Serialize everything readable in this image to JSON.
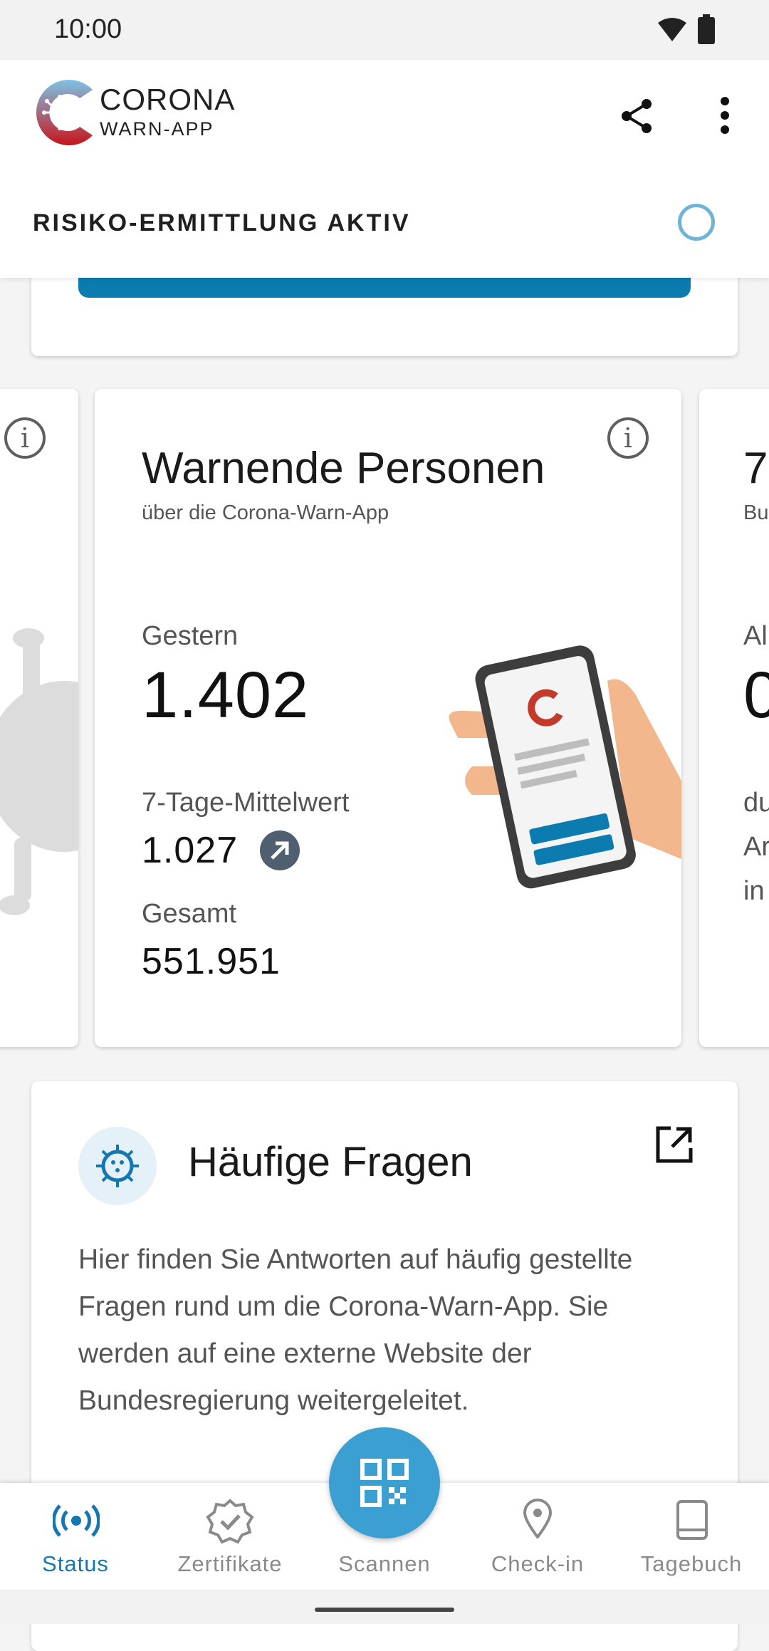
{
  "status_bar": {
    "time": "10:00"
  },
  "header": {
    "logo_line1": "CORONA",
    "logo_line2": "WARN-APP",
    "risk_label": "RISIKO-ERMITTLUNG AKTIV"
  },
  "stat_card": {
    "title": "Warnende Personen",
    "subtitle": "über die Corona-Warn-App",
    "yesterday_label": "Gestern",
    "yesterday_value": "1.402",
    "avg_label": "7-Tage-Mittelwert",
    "avg_value": "1.027",
    "total_label": "Gesamt",
    "total_value": "551.951"
  },
  "right_card_peek": {
    "title": "7",
    "subtitle": "Bu",
    "label": "Al",
    "value": "0",
    "line1": "du",
    "line2": "Ar",
    "line3": "in"
  },
  "faq": {
    "title": "Häufige Fragen",
    "body": "Hier finden Sie Antworten auf häufig gestellte Fragen rund um die Corona-Warn-App. Sie werden auf eine externe Website der Bundesregierung weitergeleitet."
  },
  "bottom_nav": {
    "items": [
      {
        "label": "Status",
        "icon": "status-broadcast-icon",
        "active": true
      },
      {
        "label": "Zertifikate",
        "icon": "certificate-badge-icon",
        "active": false
      },
      {
        "label": "Scannen",
        "icon": "qr-code-icon",
        "active": false
      },
      {
        "label": "Check-in",
        "icon": "location-pin-icon",
        "active": false
      },
      {
        "label": "Tagebuch",
        "icon": "book-icon",
        "active": false
      }
    ]
  },
  "colors": {
    "accent": "#1577b1",
    "fab": "#3b9fd2",
    "button": "#0b7bb0"
  }
}
